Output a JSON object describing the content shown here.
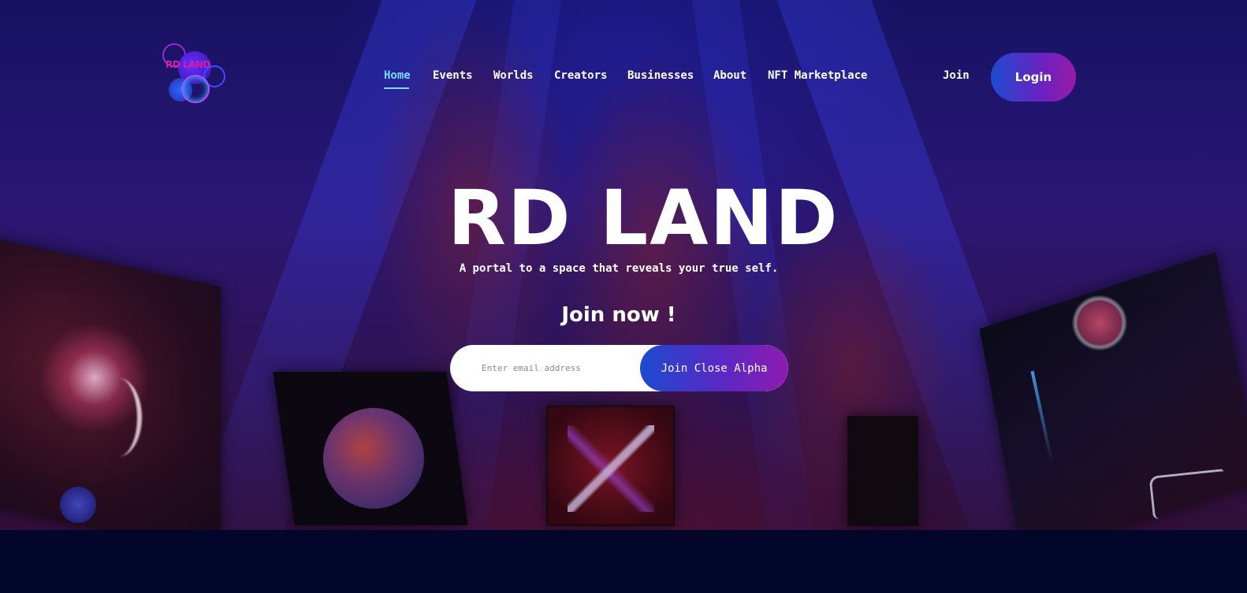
{
  "logo": {
    "text": "RD LAND"
  },
  "nav": {
    "items": [
      {
        "label": "Home",
        "active": true
      },
      {
        "label": "Events"
      },
      {
        "label": "Worlds"
      },
      {
        "label": "Creators"
      },
      {
        "label": "Businesses"
      },
      {
        "label": "About"
      },
      {
        "label": "NFT Marketplace"
      }
    ],
    "join_label": "Join",
    "login_label": "Login"
  },
  "hero": {
    "title": "RD LAND",
    "tagline": "A portal to a space that reveals your true self.",
    "cta_heading": "Join now !",
    "email_placeholder": "Enter email address",
    "submit_label": "Join Close Alpha"
  },
  "colors": {
    "accent_active": "#7fd8ff",
    "button_gradient_start": "#1f4ad0",
    "button_gradient_end": "#9a1aa8",
    "page_bottom": "#02062a"
  }
}
